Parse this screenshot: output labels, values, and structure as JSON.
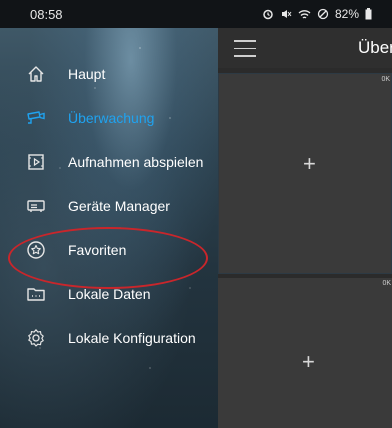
{
  "status_bar": {
    "time": "08:58",
    "battery": "82%",
    "icons": [
      "alarm-icon",
      "mute-icon",
      "wifi-icon",
      "do-not-disturb-icon",
      "battery-icon"
    ]
  },
  "sidebar": {
    "items": [
      {
        "label": "Haupt",
        "icon": "home-icon"
      },
      {
        "label": "Überwachung",
        "icon": "surveillance-icon",
        "active": true
      },
      {
        "label": "Aufnahmen abspielen",
        "icon": "playback-icon"
      },
      {
        "label": "Geräte Manager",
        "icon": "device-manager-icon"
      },
      {
        "label": "Favoriten",
        "icon": "favorite-icon"
      },
      {
        "label": "Lokale Daten",
        "icon": "folder-icon"
      },
      {
        "label": "Lokale Konfiguration",
        "icon": "settings-icon"
      }
    ]
  },
  "main": {
    "title": "Über",
    "panels": [
      {
        "status": "0K",
        "add": "+"
      },
      {
        "status": "0K",
        "add": "+"
      }
    ]
  },
  "colors": {
    "active": "#1fa3f0",
    "highlight": "#c9262b"
  }
}
